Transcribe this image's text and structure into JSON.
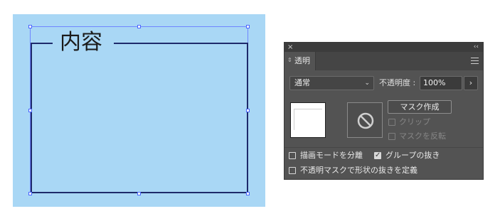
{
  "canvas": {
    "frame_title": "内容",
    "artboard_color": "#a9d7f5",
    "frame_color": "#1e2a6b",
    "selection_color": "#6f86ff"
  },
  "panel": {
    "close_glyph": "×",
    "collapse_glyph": "‹‹",
    "tab_arrows_glyph": "⇕",
    "tab_label": "透明",
    "menu_icon": "hamburger-menu-icon",
    "blend_mode": "通常",
    "opacity_label": "不透明度 :",
    "opacity_value": "100%",
    "opacity_button": "›",
    "make_mask_label": "マスク作成",
    "clip_label": "クリップ",
    "invert_mask_label": "マスクを反転",
    "isolate_blending_label": "描画モードを分離",
    "knockout_group_label": "グループの抜き",
    "opacity_mask_knockout_label": "不透明マスクで形状の抜きを定義",
    "isolate_blending_checked": false,
    "knockout_group_checked": true,
    "opacity_mask_knockout_checked": false,
    "clip_checked": false,
    "invert_mask_checked": false,
    "panel_color": "#535353"
  }
}
